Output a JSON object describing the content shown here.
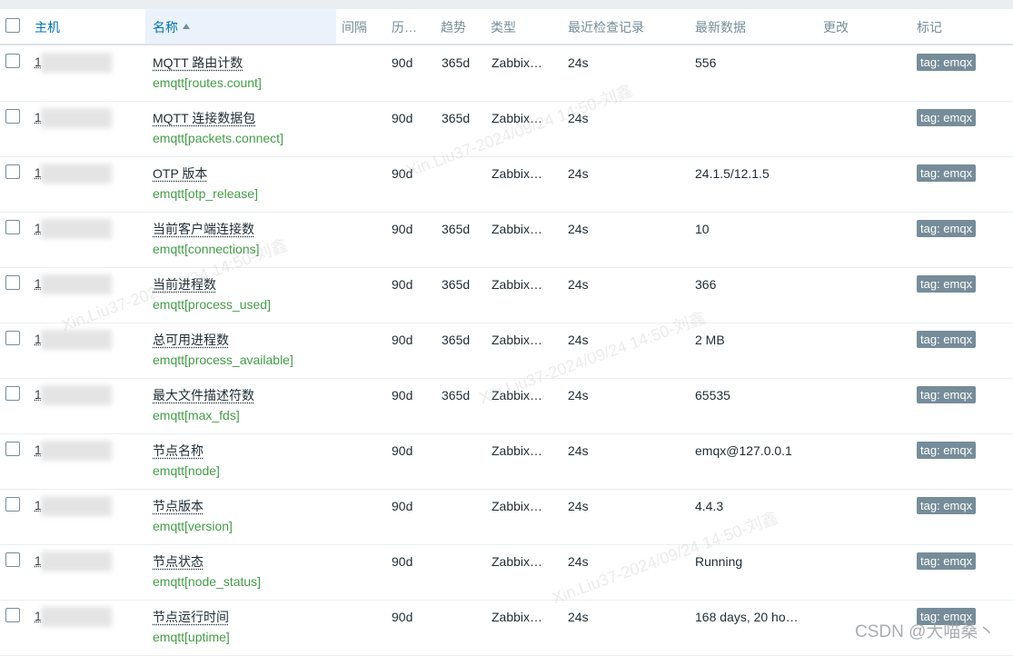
{
  "header": {
    "host": "主机",
    "name": "名称",
    "interval": "间隔",
    "history": "历…",
    "trends": "趋势",
    "type": "类型",
    "last_check": "最近检查记录",
    "last_value": "最新数据",
    "change": "更改",
    "tags": "标记"
  },
  "rows": [
    {
      "host": "1",
      "name": "MQTT 路由计数",
      "key": "emqtt[routes.count]",
      "history": "90d",
      "trends": "365d",
      "type": "Zabbix…",
      "last_check": "24s",
      "last_value": "556",
      "tag": "tag: emqx"
    },
    {
      "host": "1",
      "name": "MQTT 连接数据包",
      "key": "emqtt[packets.connect]",
      "history": "90d",
      "trends": "365d",
      "type": "Zabbix…",
      "last_check": "24s",
      "last_value": "",
      "tag": "tag: emqx"
    },
    {
      "host": "1",
      "name": "OTP 版本",
      "key": "emqtt[otp_release]",
      "history": "90d",
      "trends": "",
      "type": "Zabbix…",
      "last_check": "24s",
      "last_value": "24.1.5/12.1.5",
      "tag": "tag: emqx"
    },
    {
      "host": "1",
      "name": "当前客户端连接数",
      "key": "emqtt[connections]",
      "history": "90d",
      "trends": "365d",
      "type": "Zabbix…",
      "last_check": "24s",
      "last_value": "10",
      "tag": "tag: emqx"
    },
    {
      "host": "1",
      "name": "当前进程数",
      "key": "emqtt[process_used]",
      "history": "90d",
      "trends": "365d",
      "type": "Zabbix…",
      "last_check": "24s",
      "last_value": "366",
      "tag": "tag: emqx"
    },
    {
      "host": "1",
      "name": "总可用进程数",
      "key": "emqtt[process_available]",
      "history": "90d",
      "trends": "365d",
      "type": "Zabbix…",
      "last_check": "24s",
      "last_value": "2 MB",
      "tag": "tag: emqx"
    },
    {
      "host": "1",
      "name": "最大文件描述符数",
      "key": "emqtt[max_fds]",
      "history": "90d",
      "trends": "365d",
      "type": "Zabbix…",
      "last_check": "24s",
      "last_value": "65535",
      "tag": "tag: emqx"
    },
    {
      "host": "1",
      "name": "节点名称",
      "key": "emqtt[node]",
      "history": "90d",
      "trends": "",
      "type": "Zabbix…",
      "last_check": "24s",
      "last_value": "emqx@127.0.0.1",
      "tag": "tag: emqx"
    },
    {
      "host": "1",
      "name": "节点版本",
      "key": "emqtt[version]",
      "history": "90d",
      "trends": "",
      "type": "Zabbix…",
      "last_check": "24s",
      "last_value": "4.4.3",
      "tag": "tag: emqx"
    },
    {
      "host": "1",
      "name": "节点状态",
      "key": "emqtt[node_status]",
      "history": "90d",
      "trends": "",
      "type": "Zabbix…",
      "last_check": "24s",
      "last_value": "Running",
      "tag": "tag: emqx"
    },
    {
      "host": "1",
      "name": "节点运行时间",
      "key": "emqtt[uptime]",
      "history": "90d",
      "trends": "",
      "type": "Zabbix…",
      "last_check": "24s",
      "last_value": "168 days, 20 ho…",
      "tag": "tag: emqx"
    }
  ],
  "watermarks": [
    "Xin.Liu37-2024/09/24 14:50-刘鑫",
    "Xin.Liu37-2024/09/24 14:50-刘鑫",
    "Xin.Liu37-2024/09/24 14:50-刘鑫",
    "Xin.Liu37-2024/09/24 14:50-刘鑫"
  ],
  "csdn_watermark": "CSDN @大喵桑丶",
  "colors": {
    "link": "#0275b8",
    "key": "#429e47",
    "tag_bg": "#768d99"
  }
}
